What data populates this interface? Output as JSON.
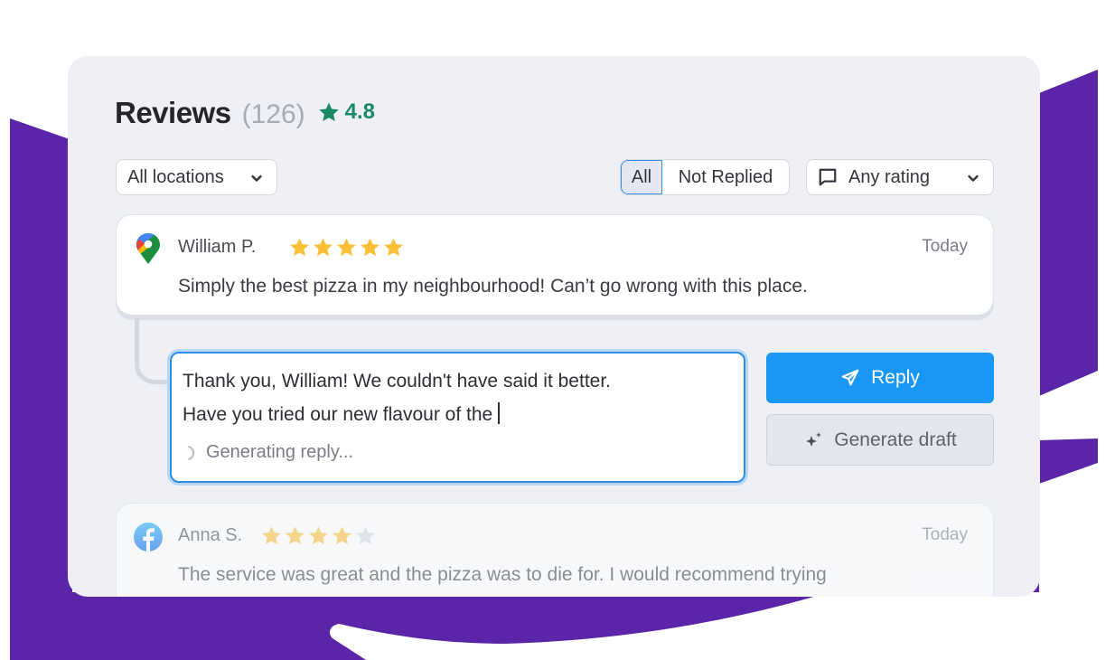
{
  "colors": {
    "brand_purple": "#5a25a8",
    "panel_bg": "#eef0f6",
    "rating_green": "#1b8a63",
    "star_gold": "#fbbf35",
    "star_empty": "#d3d7df",
    "primary_blue": "#1a97f4",
    "focus_blue": "#2f8de4"
  },
  "header": {
    "title": "Reviews",
    "count": "(126)",
    "rating_icon": "star-icon",
    "rating": "4.8"
  },
  "filters": {
    "location": {
      "value": "All locations",
      "icon": "chevron-down-icon"
    },
    "reply_status": {
      "options": [
        {
          "label": "All",
          "selected": true
        },
        {
          "label": "Not Replied",
          "selected": false
        }
      ]
    },
    "rating": {
      "value": "Any rating",
      "icon": "message-square-icon",
      "chevron": "chevron-down-icon"
    }
  },
  "reviews": [
    {
      "source_icon": "google-maps-pin-icon",
      "author": "William P.",
      "stars": 5,
      "max_stars": 5,
      "date": "Today",
      "text": "Simply the best pizza in my neighbourhood! Can’t go wrong with this place."
    },
    {
      "source_icon": "facebook-icon",
      "author": "Anna S.",
      "stars": 4,
      "max_stars": 5,
      "date": "Today",
      "text": "The service was great and the pizza was to die for. I would recommend trying"
    }
  ],
  "reply_editor": {
    "lines": [
      "Thank you, William! We couldn't have said it better.",
      "Have you tried our new flavour of the"
    ],
    "status": "Generating reply...",
    "status_icon": "spinner-icon"
  },
  "actions": {
    "reply": {
      "label": "Reply",
      "icon": "send-icon"
    },
    "generate_draft": {
      "label": "Generate draft",
      "icon": "sparkles-icon"
    }
  }
}
